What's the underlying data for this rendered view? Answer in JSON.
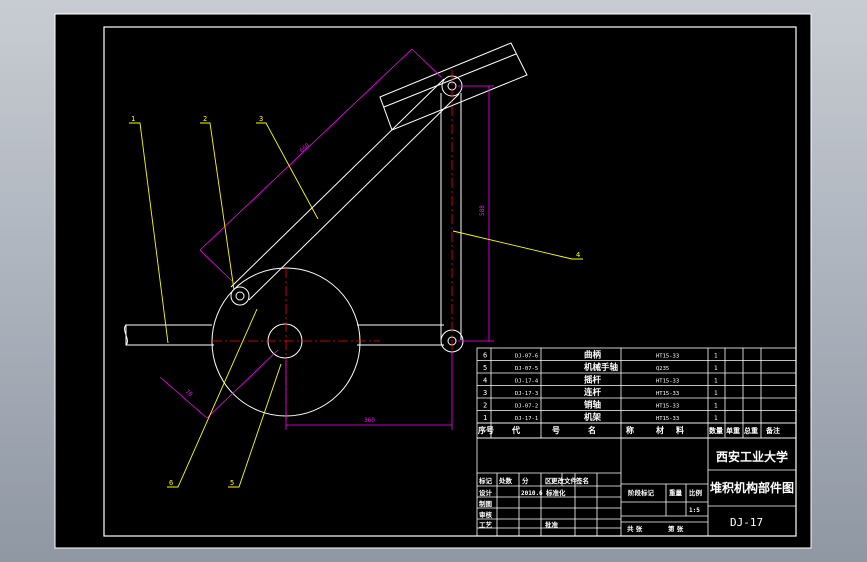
{
  "colors": {
    "background": "#a9b0ba",
    "sheet": "#000000",
    "lines": "#ffffff",
    "leaders": "#ffff00",
    "dimensions": "#ff00ff",
    "centerlines": "#ff0000"
  },
  "balloons": [
    "1",
    "2",
    "3",
    "4",
    "6",
    "5"
  ],
  "dimensions": {
    "crank_link_length": "660",
    "vertical_span": "588",
    "horizontal_offset": "360",
    "crank_radius": "70"
  },
  "parts_rows": [
    {
      "no": "6",
      "code": "DJ-07-6",
      "name": "曲柄",
      "material": "HT15-33",
      "qty": "1"
    },
    {
      "no": "5",
      "code": "DJ-07-5",
      "name": "机械手轴",
      "material": "Q235",
      "qty": "1"
    },
    {
      "no": "4",
      "code": "DJ-17-4",
      "name": "摇杆",
      "material": "HT15-33",
      "qty": "1"
    },
    {
      "no": "3",
      "code": "DJ-17-3",
      "name": "连杆",
      "material": "HT15-33",
      "qty": "1"
    },
    {
      "no": "2",
      "code": "DJ-07-2",
      "name": "销轴",
      "material": "HT15-33",
      "qty": "1"
    },
    {
      "no": "1",
      "code": "DJ-17-1",
      "name": "机架",
      "material": "HT15-33",
      "qty": "1"
    }
  ],
  "parts_header": {
    "no": "序号",
    "code": "代",
    "code2": "号",
    "name": "名",
    "name2": "称",
    "material": "材",
    "material2": "料",
    "qty": "数量",
    "single": "单重",
    "total": "总重",
    "remark": "备注"
  },
  "title_block": {
    "school": "西安工业大学",
    "drawing_title": "堆积机构部件图",
    "drawing_no": "DJ-17",
    "scale": "1:5",
    "rev_headers": [
      "标记",
      "处数",
      "分",
      "区",
      "更改文件",
      "签名"
    ],
    "sign_rows": [
      "设计",
      "制图",
      "审核",
      "工艺"
    ],
    "design_date": "2010.6",
    "standardization": "标准化",
    "approve": "批准",
    "stage_label": "阶段标记",
    "weight_label": "重量",
    "scale_label": "比例",
    "sheets_total": "共 张",
    "sheet_no": "第 张"
  }
}
